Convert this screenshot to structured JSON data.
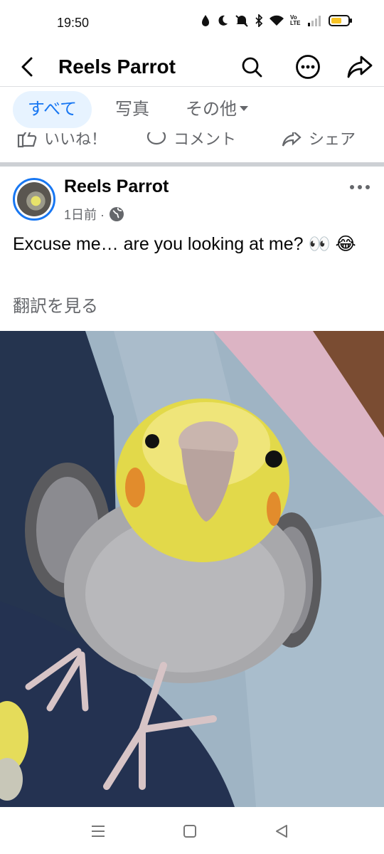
{
  "status_bar": {
    "time": "19:50",
    "icons": [
      "drop-icon",
      "moon-icon",
      "mute-icon",
      "bluetooth-icon",
      "wifi-icon",
      "volte-icon",
      "signal-icon",
      "battery-icon"
    ],
    "volte_label": "Vo LTE",
    "battery_color": "#f7c325"
  },
  "header": {
    "title": "Reels Parrot",
    "icons": [
      "back-icon",
      "search-icon",
      "more-icon",
      "share-icon"
    ]
  },
  "tabs": [
    {
      "label": "すべて",
      "active": true
    },
    {
      "label": "写真",
      "active": false
    },
    {
      "label": "その他",
      "active": false
    }
  ],
  "prev_post_actions": {
    "like": "いいね！",
    "comment": "コメント",
    "share": "シェア"
  },
  "post": {
    "author": "Reels Parrot",
    "time": "1日前 ·",
    "privacy_icon": "globe-icon",
    "text": "Excuse me… are you looking at me? 👀 😂",
    "translate": "翻訳を見る"
  },
  "colors": {
    "accent": "#1877f2",
    "accent_bg": "#e7f3ff",
    "secondary_text": "#65676b",
    "separator": "#cdd0d4"
  }
}
